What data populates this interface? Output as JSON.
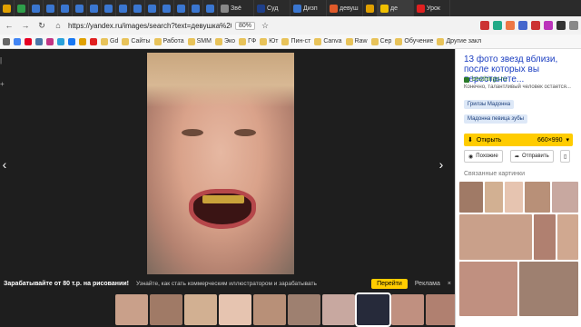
{
  "browser": {
    "tabs": [
      {
        "label": "",
        "color": "#e0a000"
      },
      {
        "label": "",
        "color": "#2e9e4a"
      },
      {
        "label": "",
        "color": "#3a76d0"
      },
      {
        "label": "",
        "color": "#3a76d0"
      },
      {
        "label": "",
        "color": "#3a76d0"
      },
      {
        "label": "",
        "color": "#3a76d0"
      },
      {
        "label": "",
        "color": "#3a76d0"
      },
      {
        "label": "",
        "color": "#3a76d0"
      },
      {
        "label": "",
        "color": "#3a76d0"
      },
      {
        "label": "",
        "color": "#3a76d0"
      },
      {
        "label": "",
        "color": "#3a76d0"
      },
      {
        "label": "",
        "color": "#3a76d0"
      },
      {
        "label": "",
        "color": "#3a76d0"
      },
      {
        "label": "",
        "color": "#3a76d0"
      },
      {
        "label": "",
        "color": "#3a76d0"
      },
      {
        "label": "Звё",
        "color": "#888888"
      },
      {
        "label": "Суд",
        "color": "#1e3f8a"
      },
      {
        "label": "Дизп",
        "color": "#3a76d0"
      },
      {
        "label": "девуш",
        "color": "#e05a2a"
      },
      {
        "label": "",
        "color": "#e0a000"
      },
      {
        "label": "де",
        "color": "#f0c000"
      },
      {
        "label": "Урок",
        "color": "#e02020"
      }
    ],
    "url": "https://yandex.ru/images/search?text=девушка%20",
    "zoom": "80%",
    "bookmarks": [
      "Gd",
      "Сайты",
      "Работа",
      "SMM",
      "Эко",
      "ГФ",
      "Ют",
      "Пин-ст",
      "Canva",
      "Raw",
      "Сер",
      "Обучение",
      "Другие закл"
    ]
  },
  "viewer": {
    "promo_text_bold": "Зарабатывайте от 80 т.р. на рисовании!",
    "promo_text": "Узнайте, как стать коммерческим иллюстратором и зарабатывать на своем творчестве!",
    "promo_button": "Перейти",
    "promo_ad": "Реклама",
    "thumbs": [
      "#c9a08a",
      "#a07a66",
      "#d2b092",
      "#e6c4b0",
      "#b89078",
      "#9e8070",
      "#c8a8a0",
      "#262a3a",
      "#c09080",
      "#b08070",
      "#d0a890"
    ]
  },
  "panel": {
    "title": "13 фото звезд вблизи, после которых вы перестанете...",
    "source": "besthings.ru",
    "description": "Конечно, талантливый человек остается...",
    "tags": [
      "Грилзы Мадонна",
      "Мадонна певица зубы"
    ],
    "open_label": "Открыть",
    "size": "660×990",
    "similar_label": "Похожие",
    "share_label": "Отправить",
    "related_title": "Связанные картинки"
  }
}
